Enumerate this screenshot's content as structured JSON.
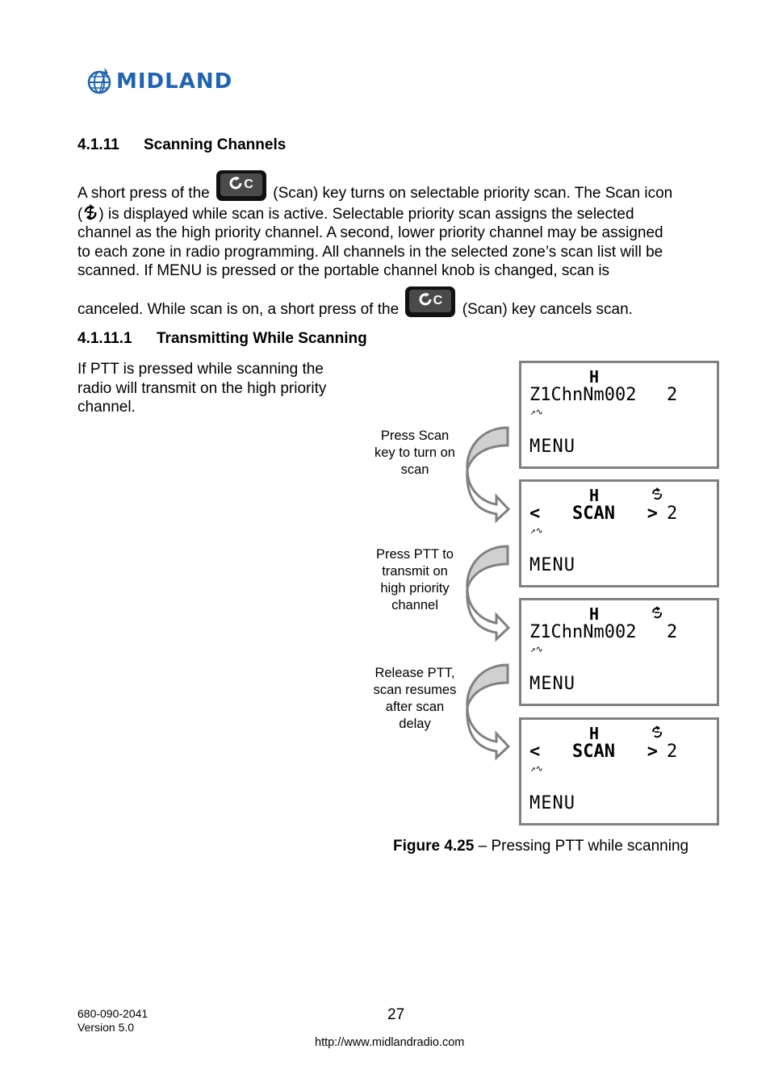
{
  "logo": {
    "brand": "MIDLAND",
    "icon": "globe-logo-icon",
    "color": "#1f64b4"
  },
  "section": {
    "number": "4.1.11",
    "title": "Scanning Channels"
  },
  "paragraph1": {
    "line1_pre": "A short press of the",
    "key_label": "C",
    "key_icon": "scan-key-icon",
    "line1_post": "(Scan) key turns on selectable priority scan. The Scan icon",
    "line2_pre": "(",
    "scan_icon": "scan-status-icon",
    "line2_post": ") is displayed while scan is active. Selectable priority scan assigns the selected",
    "line3": "channel as the high priority channel. A second, lower priority channel may be assigned",
    "line4": "to each zone in radio programming. All channels in the selected zone’s scan list will be",
    "line5": "scanned. If MENU is pressed or the portable channel knob is changed, scan is",
    "line6_pre": "canceled. While scan is on, a short press of the",
    "line6_post": "(Scan) key cancels scan."
  },
  "subsection": {
    "number": "4.1.11.1",
    "title": "Transmitting While Scanning"
  },
  "paragraph2": "If PTT is pressed while scanning the radio will transmit on the high priority channel.",
  "figure": {
    "screens": [
      {
        "power": "H",
        "line2": "Z1ChnNm002",
        "channel": "2",
        "scan_icon": false,
        "menu": "MENU",
        "icons": "↗∿"
      },
      {
        "power": "H",
        "line2": "<   SCAN   >",
        "channel": "2",
        "scan_icon": true,
        "menu": "MENU",
        "icons": "↗∿"
      },
      {
        "power": "H",
        "line2": "Z1ChnNm002",
        "channel": "2",
        "scan_icon": true,
        "menu": "MENU",
        "icons": "↗∿"
      },
      {
        "power": "H",
        "line2": "<   SCAN   >",
        "channel": "2",
        "scan_icon": true,
        "menu": "MENU",
        "icons": "↗∿"
      }
    ],
    "steps": [
      "Press Scan key to turn on scan",
      "Press PTT to transmit on high priority channel",
      "Release PTT, scan resumes after scan delay"
    ],
    "caption_bold": "Figure 4.25",
    "caption_text": " – Pressing PTT while scanning"
  },
  "footer": {
    "doc_number": "680-090-2041",
    "version": "Version 5.0",
    "page": "27",
    "url": "http://www.midlandradio.com"
  }
}
